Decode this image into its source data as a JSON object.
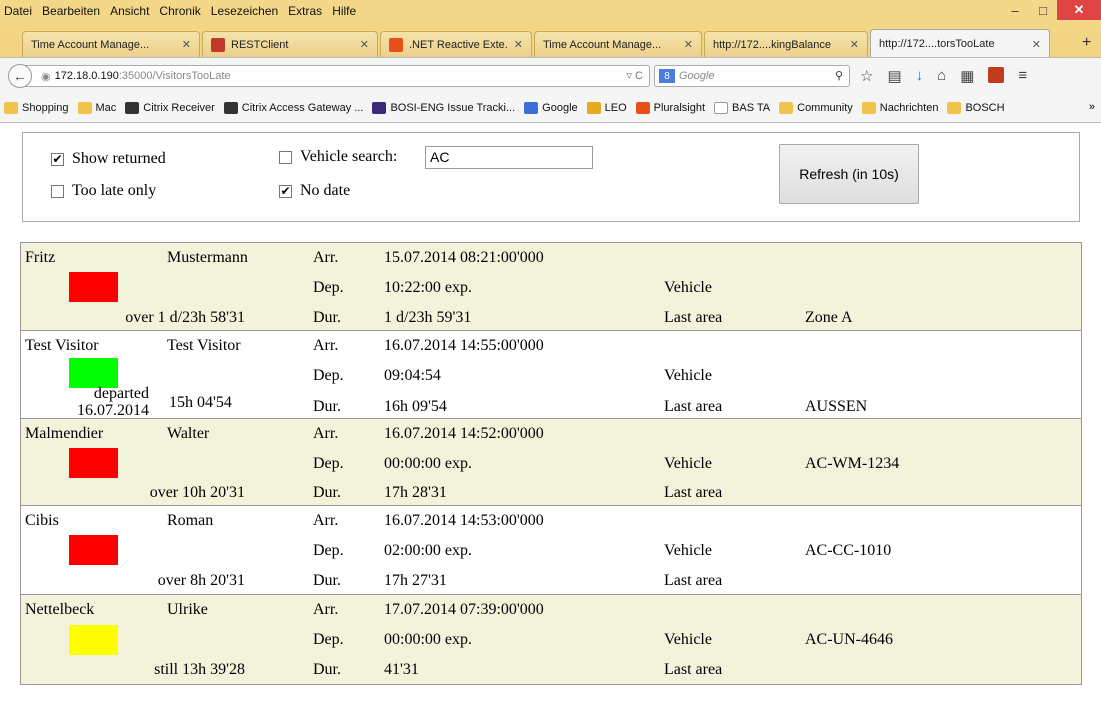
{
  "menu": [
    "Datei",
    "Bearbeiten",
    "Ansicht",
    "Chronik",
    "Lesezeichen",
    "Extras",
    "Hilfe"
  ],
  "tabs": [
    {
      "label": "Time Account Manage...",
      "icon": "none",
      "color": ""
    },
    {
      "label": "RESTClient",
      "icon": "restclient-icon",
      "color": "#c0392b"
    },
    {
      "label": ".NET Reactive Exte...",
      "icon": "channel9-icon",
      "color": "#e8501a"
    },
    {
      "label": "Time Account Manage...",
      "icon": "none",
      "color": ""
    },
    {
      "label": "http://172....kingBalance",
      "icon": "none",
      "color": ""
    },
    {
      "label": "http://172....torsTooLate",
      "icon": "none",
      "color": ""
    }
  ],
  "nav": {
    "url_host": "172.18.0.190",
    "url_rest": ":35000/VisitorsTooLate",
    "search_placeholder": "Google"
  },
  "bookmarks": [
    {
      "label": "Shopping",
      "icon": "folder-icon"
    },
    {
      "label": "Mac",
      "icon": "folder-icon"
    },
    {
      "label": "Citrix Receiver",
      "icon": "citrix-icon"
    },
    {
      "label": "Citrix Access Gateway ...",
      "icon": "citrix-icon"
    },
    {
      "label": "BOSI-ENG Issue Tracki...",
      "icon": "vs-icon"
    },
    {
      "label": "Google",
      "icon": "google-icon"
    },
    {
      "label": "LEO",
      "icon": "leo-icon"
    },
    {
      "label": "Pluralsight",
      "icon": "pluralsight-icon"
    },
    {
      "label": "BAS TA",
      "icon": "page-icon"
    },
    {
      "label": "Community",
      "icon": "folder-icon"
    },
    {
      "label": "Nachrichten",
      "icon": "folder-icon"
    },
    {
      "label": "BOSCH",
      "icon": "folder-icon"
    }
  ],
  "bookmarks_more": "»",
  "filters": {
    "show_returned": {
      "label": "Show returned",
      "checked": true
    },
    "too_late_only": {
      "label": "Too late only",
      "checked": false
    },
    "vehicle_search": {
      "label": "Vehicle search:",
      "checked": false,
      "value": "AC"
    },
    "no_date": {
      "label": "No date",
      "checked": true
    },
    "refresh_label": "Refresh (in 10s)"
  },
  "labels": {
    "arr": "Arr.",
    "dep": "Dep.",
    "dur": "Dur.",
    "vehicle": "Vehicle",
    "last_area": "Last area"
  },
  "visitors": [
    {
      "first": "Fritz",
      "last": "Mustermann",
      "lamp": "#ff0000",
      "status": "over 1 d/23h 58'31",
      "arr": "15.07.2014 08:21:00'000",
      "dep": "10:22:00 exp.",
      "dur": "1 d/23h 59'31",
      "vehicle": "",
      "area": "Zone A"
    },
    {
      "first": "Test Visitor",
      "last": "Test Visitor",
      "lamp": "#00ff00",
      "status_line1": "departed",
      "status_line2": "16.07.2014",
      "status_right": "15h 04'54",
      "arr": "16.07.2014 14:55:00'000",
      "dep": "09:04:54",
      "dur": "16h 09'54",
      "vehicle": "",
      "area": "AUSSEN"
    },
    {
      "first": "Malmendier",
      "last": "Walter",
      "lamp": "#ff0000",
      "status": "over 10h 20'31",
      "arr": "16.07.2014 14:52:00'000",
      "dep": "00:00:00 exp.",
      "dur": "17h 28'31",
      "vehicle": "AC-WM-1234",
      "area": ""
    },
    {
      "first": "Cibis",
      "last": "Roman",
      "lamp": "#ff0000",
      "status": "over 8h 20'31",
      "arr": "16.07.2014 14:53:00'000",
      "dep": "02:00:00 exp.",
      "dur": "17h 27'31",
      "vehicle": "AC-CC-1010",
      "area": ""
    },
    {
      "first": "Nettelbeck",
      "last": "Ulrike",
      "lamp": "#ffff00",
      "status": "still 13h 39'28",
      "arr": "17.07.2014 07:39:00'000",
      "dep": "00:00:00 exp.",
      "dur": "41'31",
      "vehicle": "AC-UN-4646",
      "area": ""
    }
  ]
}
